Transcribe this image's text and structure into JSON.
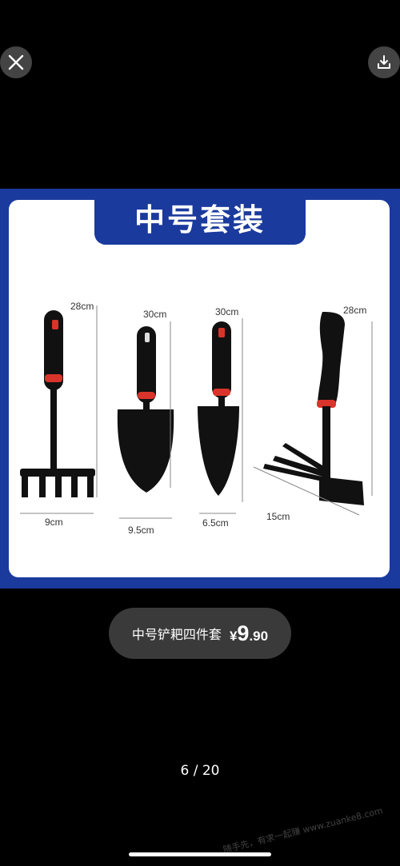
{
  "viewer": {
    "close_icon": "close-icon",
    "download_icon": "download-icon",
    "counter": "6 / 20"
  },
  "product_image": {
    "title": "中号套装",
    "tools": [
      {
        "name": "rake",
        "height": "28cm",
        "width": "9cm"
      },
      {
        "name": "trowel-wide",
        "height": "30cm",
        "width": "9.5cm"
      },
      {
        "name": "trowel-narrow",
        "height": "30cm",
        "width": "6.5cm"
      },
      {
        "name": "hoe-fork",
        "height": "28cm",
        "width": "15cm"
      }
    ]
  },
  "price_tag": {
    "name": "中号铲耙四件套",
    "currency": "¥",
    "price_int": "9",
    "price_dec": ".90"
  },
  "watermark": "随手先，有求一起赚 www.zuanke8.com",
  "colors": {
    "brand_blue": "#1b3a9d",
    "pill_bg": "#3a3a3a",
    "accent_red": "#d9342b"
  }
}
